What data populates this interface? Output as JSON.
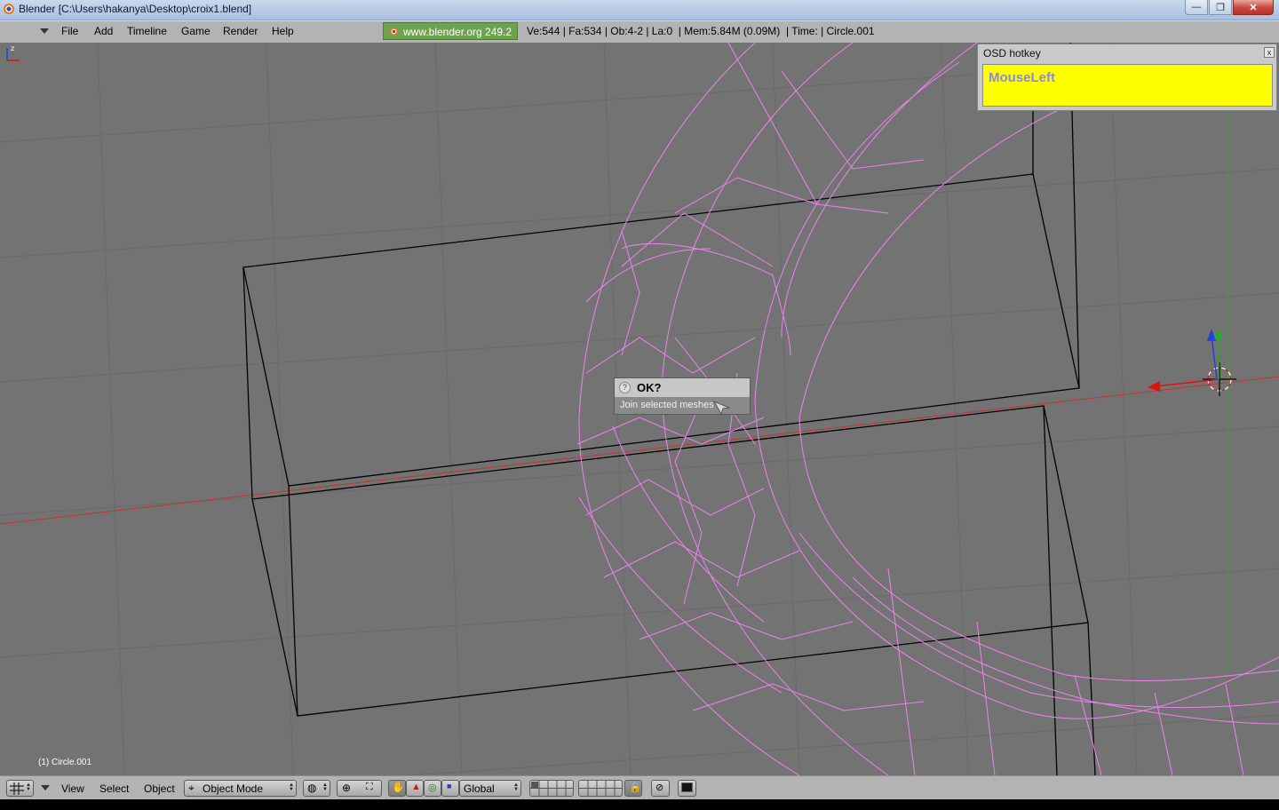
{
  "window": {
    "title": "Blender [C:\\Users\\hakanya\\Desktop\\croix1.blend]",
    "controls": {
      "minimize": "—",
      "maximize": "❐",
      "close": "✕"
    }
  },
  "menubar": {
    "items": [
      "File",
      "Add",
      "Timeline",
      "Game",
      "Render",
      "Help"
    ],
    "url_badge": "www.blender.org 249.2",
    "stats": "Ve:544 | Fa:534 | Ob:4-2 | La:0  | Mem:5.84M (0.09M)  | Time: | Circle.001"
  },
  "osd": {
    "title": "OSD hotkey",
    "close": "x",
    "key": "MouseLeft"
  },
  "dialog": {
    "icon": "?",
    "title": "OK?",
    "item": "Join selected meshes"
  },
  "viewport": {
    "object_info": "(1) Circle.001",
    "axis_label": "z"
  },
  "bottombar": {
    "menus": [
      "View",
      "Select",
      "Object"
    ],
    "mode": "Object Mode",
    "orientation": "Global"
  },
  "colors": {
    "viewport_bg": "#737373",
    "wire_selected": "#ee82ee",
    "wire_unselected": "#000000",
    "x_axis": "#c83232",
    "osd_yellow": "#ffff00"
  }
}
